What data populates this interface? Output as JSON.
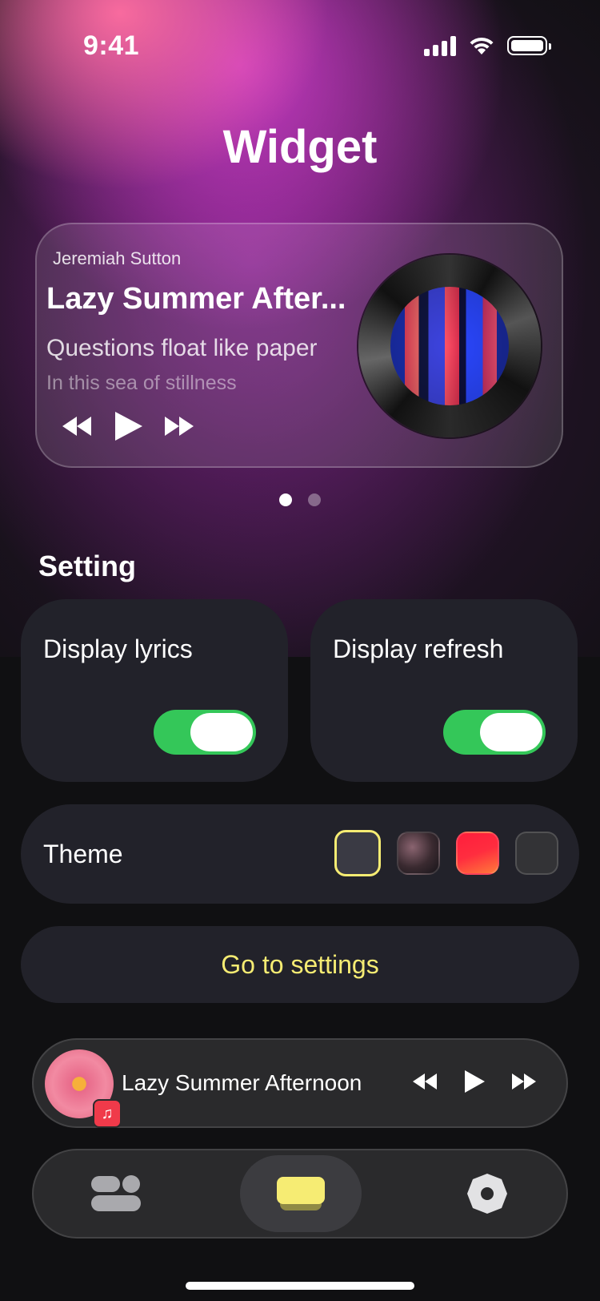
{
  "status_bar": {
    "time": "9:41"
  },
  "page": {
    "title": "Widget"
  },
  "widget": {
    "artist": "Jeremiah Sutton",
    "title": "Lazy Summer After...",
    "lyric_current": "Questions float like paper",
    "lyric_next": "In this sea of stillness",
    "controls": [
      "rewind-icon",
      "play-icon",
      "fast-forward-icon"
    ],
    "page_count": 2,
    "active_page": 1
  },
  "settings": {
    "section_title": "Setting",
    "toggles": [
      {
        "label": "Display lyrics",
        "on": true
      },
      {
        "label": "Display refresh",
        "on": true
      }
    ],
    "theme": {
      "label": "Theme",
      "options": [
        "#3a3a44",
        "#5a3f48",
        "#ff2d3f",
        "#333336"
      ],
      "selected_index": 0
    },
    "go_button": "Go to settings"
  },
  "mini_player": {
    "title": "Lazy Summer Afternoon",
    "badge_icon": "music-note-icon"
  },
  "tab_bar": {
    "tabs": [
      "widgets-icon",
      "widget-card-icon",
      "settings-gear-icon"
    ],
    "active_index": 1
  },
  "colors": {
    "accent_yellow": "#f6ec73",
    "toggle_green": "#34c759",
    "card_bg": "#22222a"
  }
}
